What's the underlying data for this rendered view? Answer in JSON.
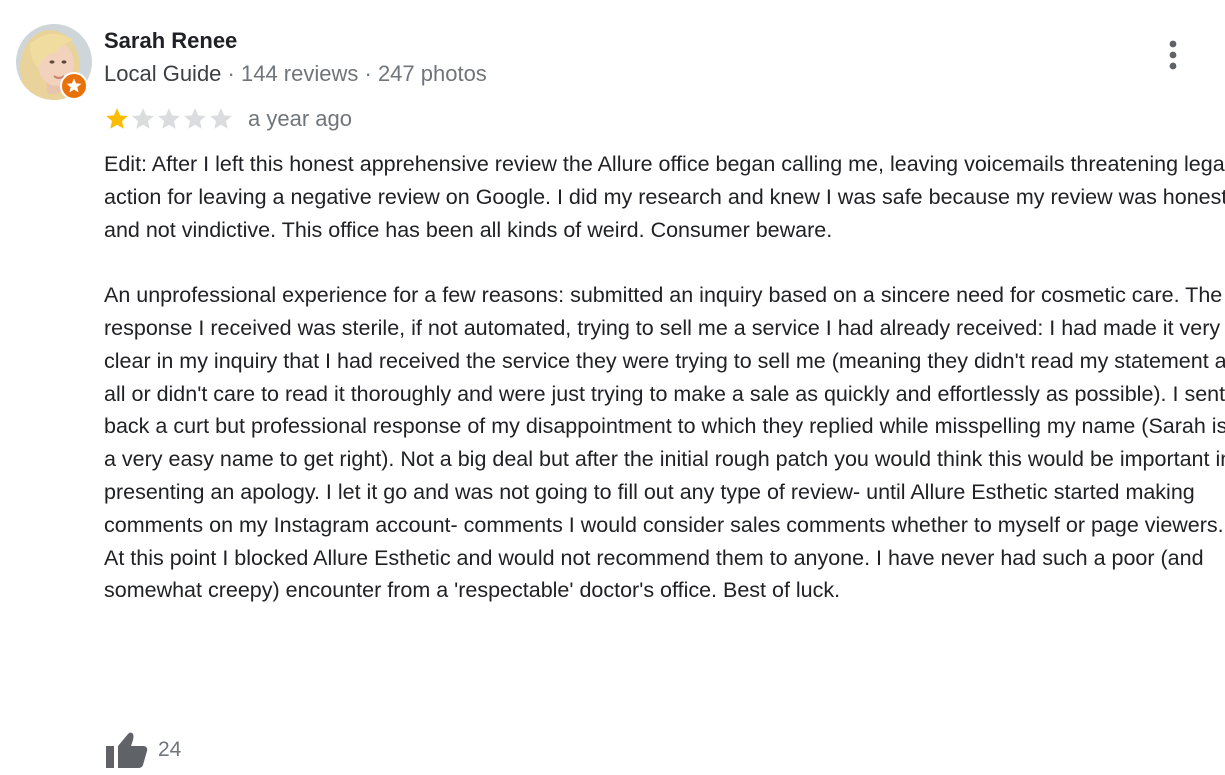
{
  "reviewer": {
    "name": "Sarah Renee",
    "guide_label": "Local Guide",
    "separator": " · ",
    "reviews": "144 reviews",
    "photos": "247 photos"
  },
  "review": {
    "rating": 1,
    "max_rating": 5,
    "date": "a year ago",
    "paragraphs": [
      "Edit: After I left this honest apprehensive review the Allure office began calling me, leaving voicemails threatening legal action for leaving a negative review on Google. I did my research and knew I was safe because my review was honest and not vindictive. This office has been all kinds of weird. Consumer beware.",
      "An unprofessional experience for a few reasons: submitted an inquiry based on a sincere need for cosmetic care. The response I received was sterile, if not automated, trying to sell me a service I had already received: I had made it very clear in my inquiry that I had received the service they were trying to sell me (meaning they didn't read my statement at all or didn't care to read it thoroughly and were just trying to make a sale as quickly and effortlessly as possible). I sent back a curt but professional response of my disappointment to which they replied while misspelling my name (Sarah is a very easy name to get right). Not a big deal but after the initial rough patch you would think this would be important in presenting an apology. I let it go and was not going to fill out any type of review- until Allure Esthetic started making comments on my Instagram account- comments I would consider sales comments whether to myself or page viewers. At this point I blocked Allure Esthetic and would not recommend them to anyone. I have never had such a poor (and somewhat creepy) encounter from a 'respectable' doctor's office. Best of luck."
    ],
    "likes": "24"
  },
  "icons": {
    "avatar": "avatar",
    "guide_badge": "local-guide-badge-icon",
    "more": "more-vert-icon",
    "star_filled": "star-filled-icon",
    "star_empty": "star-empty-icon",
    "like": "thumbs-up-icon"
  },
  "colors": {
    "star_filled": "#fbbc04",
    "star_empty": "#dadce0",
    "guide_badge": "#e8710a",
    "meta_text": "#70757a",
    "body_text": "#202124"
  }
}
